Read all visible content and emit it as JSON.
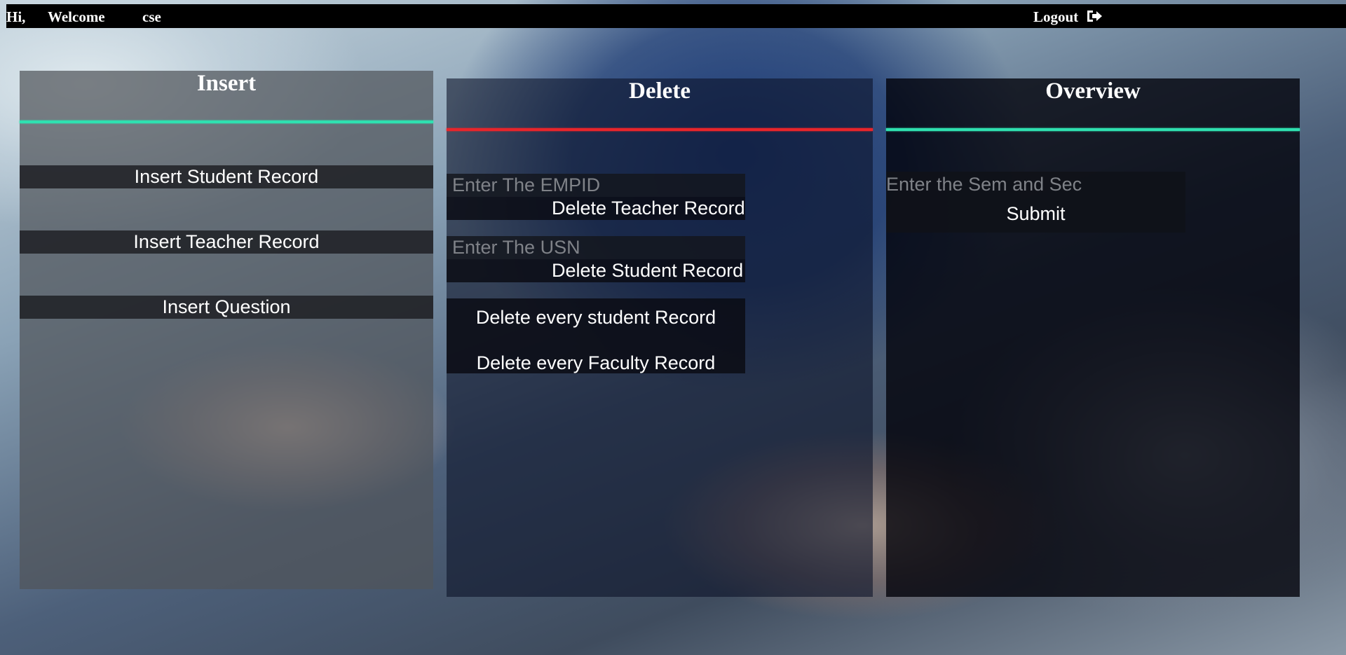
{
  "topbar": {
    "hi": "Hi,",
    "welcome": "Welcome",
    "user": "cse",
    "logout_label": "Logout",
    "logout_icon": "logout-icon"
  },
  "insert": {
    "title": "Insert",
    "accent": "#2fe0b0",
    "buttons": [
      "Insert Student Record",
      "Insert Teacher Record",
      "Insert Question"
    ]
  },
  "delete": {
    "title": "Delete",
    "accent": "#e8252b",
    "empid_placeholder": "Enter The EMPID",
    "teacher_btn": "Delete Teacher Record",
    "usn_placeholder": "Enter The USN",
    "student_btn": "Delete Student Record",
    "every_student_btn": "Delete every student Record",
    "every_faculty_btn": "Delete every Faculty Record"
  },
  "overview": {
    "title": "Overview",
    "accent": "#2fe0b0",
    "sem_placeholder": "Enter the Sem and Sec",
    "submit": "Submit"
  }
}
